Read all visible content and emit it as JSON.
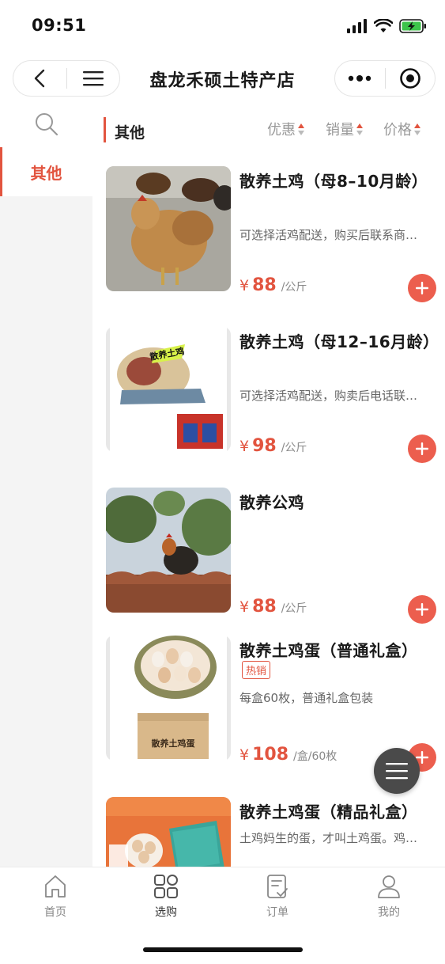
{
  "status_bar": {
    "time": "09:51"
  },
  "nav": {
    "title": "盘龙禾硕土特产店"
  },
  "sidebar": {
    "categories": [
      {
        "label": "其他"
      }
    ]
  },
  "filter": {
    "category_title": "其他",
    "sorts": [
      {
        "label": "优惠"
      },
      {
        "label": "销量"
      },
      {
        "label": "价格"
      }
    ]
  },
  "products": [
    {
      "name": "散养土鸡（母8–10月龄）",
      "desc": "可选择活鸡配送，购买后联系商…",
      "currency": "¥",
      "price": "88",
      "unit": "/公斤",
      "image": "hen-photo"
    },
    {
      "name": "散养土鸡（母12–16月龄）",
      "desc": "可选择活鸡配送，购卖后电话联…",
      "currency": "¥",
      "price": "98",
      "unit": "/公斤",
      "image": "dressed-chicken-giftbox-photo",
      "image_caption": "散养土鸡"
    },
    {
      "name": "散养公鸡",
      "desc": "",
      "currency": "¥",
      "price": "88",
      "unit": "/公斤",
      "image": "rooster-on-roof-photo"
    },
    {
      "name": "散养土鸡蛋（普通礼盒）",
      "tag": "热销",
      "desc": "每盒60枚，普通礼盒包装",
      "currency": "¥",
      "price": "108",
      "unit": "/盒/60枚",
      "image": "eggs-basket-box-photo",
      "image_caption": "散养土鸡蛋"
    },
    {
      "name": "散养土鸡蛋（精品礼盒）",
      "desc": "土鸡妈生的蛋，才叫土鸡蛋。鸡…",
      "image": "premium-egg-giftbox-photo"
    }
  ],
  "tab_bar": {
    "tabs": [
      {
        "label": "首页",
        "icon": "home-icon"
      },
      {
        "label": "选购",
        "icon": "grid-icon",
        "active": true
      },
      {
        "label": "订单",
        "icon": "order-icon"
      },
      {
        "label": "我的",
        "icon": "user-icon"
      }
    ]
  },
  "colors": {
    "accent": "#e2543f",
    "add_button": "#ec5e4e",
    "sidebar_bg": "#f4f4f4",
    "float_menu": "#4a4a4a"
  }
}
